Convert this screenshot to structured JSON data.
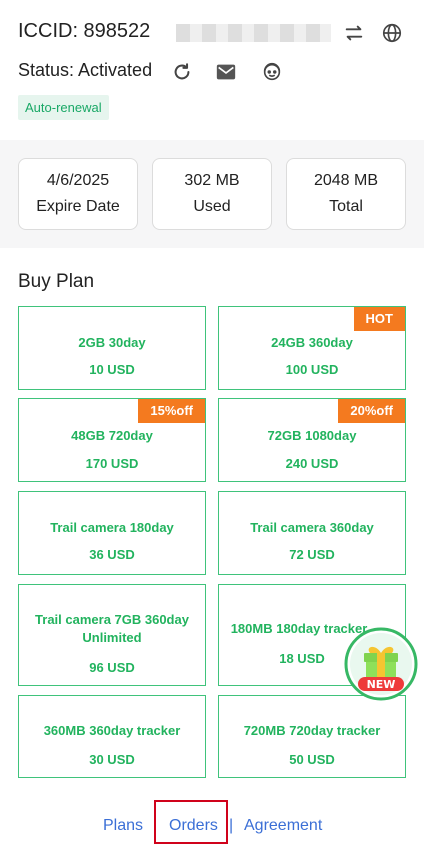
{
  "header": {
    "iccid_label": "ICCID: 898522",
    "status_label": "Status: Activated",
    "badge": "Auto-renewal",
    "icons": [
      "swap-icon",
      "globe-icon",
      "refresh-icon",
      "mail-icon",
      "support-icon"
    ]
  },
  "summary": {
    "cards": [
      {
        "value": "4/6/2025",
        "label": "Expire Date"
      },
      {
        "value": "302 MB",
        "label": "Used"
      },
      {
        "value": "2048 MB",
        "label": "Total"
      }
    ]
  },
  "buy_plan": {
    "title": "Buy Plan",
    "plans": [
      {
        "name": "2GB 30day",
        "price": "10 USD",
        "tag": ""
      },
      {
        "name": "24GB 360day",
        "price": "100 USD",
        "tag": "HOT"
      },
      {
        "name": "48GB 720day",
        "price": "170 USD",
        "tag": "15%off"
      },
      {
        "name": "72GB 1080day",
        "price": "240 USD",
        "tag": "20%off"
      },
      {
        "name": "Trail camera 180day",
        "price": "36 USD",
        "tag": ""
      },
      {
        "name": "Trail camera 360day",
        "price": "72 USD",
        "tag": ""
      },
      {
        "name": "Trail camera 7GB 360day Unlimited",
        "price": "96 USD",
        "tag": ""
      },
      {
        "name": "180MB 180day tracker",
        "price": "18 USD",
        "tag": ""
      },
      {
        "name": "360MB 360day tracker",
        "price": "30 USD",
        "tag": ""
      },
      {
        "name": "720MB 720day tracker",
        "price": "50 USD",
        "tag": ""
      }
    ],
    "gift_badge": "NEW"
  },
  "footer": {
    "plans": "Plans",
    "orders": "Orders",
    "separator": "|",
    "agreement": "Agreement"
  },
  "colors": {
    "accent_green": "#22b35e",
    "tag_orange": "#f47a1f",
    "link_blue": "#3b6fd6",
    "highlight_red": "#d0021b"
  }
}
